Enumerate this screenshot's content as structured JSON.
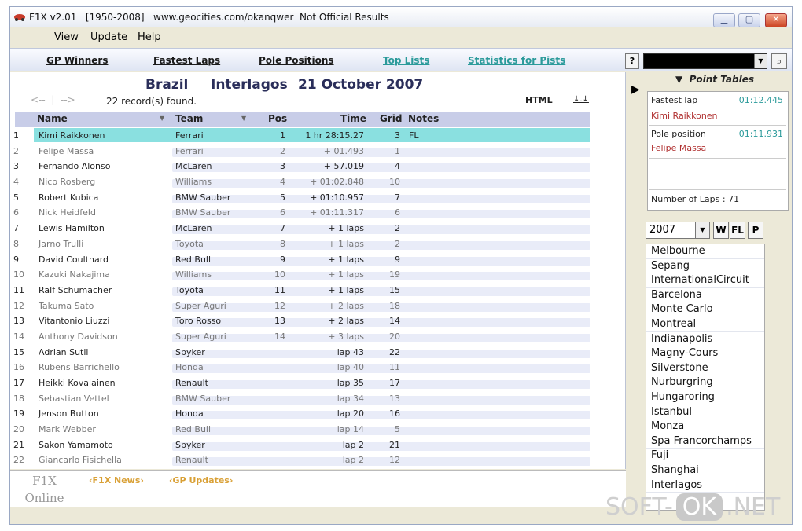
{
  "window": {
    "title": "F1X v2.01   [1950-2008]   www.geocities.com/okanqwer  Not Official Results"
  },
  "menu": {
    "items": [
      "View",
      "Update",
      "Help"
    ]
  },
  "nav": {
    "gp_winners": "GP Winners",
    "fastest_laps": "Fastest Laps",
    "pole_positions": "Pole Positions",
    "top_lists": "Top Lists",
    "statistics": "Statistics for Pists",
    "help": "?"
  },
  "race": {
    "country": "Brazil",
    "circuit": "Interlagos",
    "date": "21 October 2007"
  },
  "pager": {
    "back": "<--  |  -->",
    "records": "22  record(s) found.",
    "html": "HTML",
    "sort": "↓.↓"
  },
  "columns": {
    "name": "Name",
    "team": "Team",
    "pos": "Pos",
    "time": "Time",
    "grid": "Grid",
    "notes": "Notes"
  },
  "results": [
    {
      "n": "1",
      "name": "Kimi Raikkonen",
      "team": "Ferrari",
      "pos": "1",
      "time": "1 hr 28:15.27",
      "grid": "3",
      "notes": "FL"
    },
    {
      "n": "2",
      "name": "Felipe Massa",
      "team": "Ferrari",
      "pos": "2",
      "time": "+ 01.493",
      "grid": "1",
      "notes": ""
    },
    {
      "n": "3",
      "name": "Fernando Alonso",
      "team": "McLaren",
      "pos": "3",
      "time": "+ 57.019",
      "grid": "4",
      "notes": ""
    },
    {
      "n": "4",
      "name": "Nico Rosberg",
      "team": "Williams",
      "pos": "4",
      "time": "+ 01:02.848",
      "grid": "10",
      "notes": ""
    },
    {
      "n": "5",
      "name": "Robert Kubica",
      "team": "BMW Sauber",
      "pos": "5",
      "time": "+ 01:10.957",
      "grid": "7",
      "notes": ""
    },
    {
      "n": "6",
      "name": "Nick Heidfeld",
      "team": "BMW Sauber",
      "pos": "6",
      "time": "+ 01:11.317",
      "grid": "6",
      "notes": ""
    },
    {
      "n": "7",
      "name": "Lewis Hamilton",
      "team": "McLaren",
      "pos": "7",
      "time": "+ 1 laps",
      "grid": "2",
      "notes": ""
    },
    {
      "n": "8",
      "name": "Jarno Trulli",
      "team": "Toyota",
      "pos": "8",
      "time": "+ 1 laps",
      "grid": "2",
      "notes": ""
    },
    {
      "n": "9",
      "name": "David Coulthard",
      "team": "Red Bull",
      "pos": "9",
      "time": "+ 1 laps",
      "grid": "9",
      "notes": ""
    },
    {
      "n": "10",
      "name": "Kazuki Nakajima",
      "team": "Williams",
      "pos": "10",
      "time": "+ 1 laps",
      "grid": "19",
      "notes": ""
    },
    {
      "n": "11",
      "name": "Ralf Schumacher",
      "team": "Toyota",
      "pos": "11",
      "time": "+ 1 laps",
      "grid": "15",
      "notes": ""
    },
    {
      "n": "12",
      "name": "Takuma Sato",
      "team": "Super Aguri",
      "pos": "12",
      "time": "+ 2 laps",
      "grid": "18",
      "notes": ""
    },
    {
      "n": "13",
      "name": "Vitantonio Liuzzi",
      "team": "Toro Rosso",
      "pos": "13",
      "time": "+ 2 laps",
      "grid": "14",
      "notes": ""
    },
    {
      "n": "14",
      "name": "Anthony Davidson",
      "team": "Super Aguri",
      "pos": "14",
      "time": "+ 3 laps",
      "grid": "20",
      "notes": ""
    },
    {
      "n": "15",
      "name": "Adrian Sutil",
      "team": "Spyker",
      "pos": "",
      "time": "lap 43",
      "grid": "22",
      "notes": ""
    },
    {
      "n": "16",
      "name": "Rubens Barrichello",
      "team": "Honda",
      "pos": "",
      "time": "lap 40",
      "grid": "11",
      "notes": ""
    },
    {
      "n": "17",
      "name": "Heikki Kovalainen",
      "team": "Renault",
      "pos": "",
      "time": "lap 35",
      "grid": "17",
      "notes": ""
    },
    {
      "n": "18",
      "name": "Sebastian Vettel",
      "team": "BMW Sauber",
      "pos": "",
      "time": "lap 34",
      "grid": "13",
      "notes": ""
    },
    {
      "n": "19",
      "name": "Jenson Button",
      "team": "Honda",
      "pos": "",
      "time": "lap 20",
      "grid": "16",
      "notes": ""
    },
    {
      "n": "20",
      "name": "Mark Webber",
      "team": "Red Bull",
      "pos": "",
      "time": "lap 14",
      "grid": "5",
      "notes": ""
    },
    {
      "n": "21",
      "name": "Sakon Yamamoto",
      "team": "Spyker",
      "pos": "",
      "time": "lap 2",
      "grid": "21",
      "notes": ""
    },
    {
      "n": "22",
      "name": "Giancarlo Fisichella",
      "team": "Renault",
      "pos": "",
      "time": "lap 2",
      "grid": "12",
      "notes": ""
    }
  ],
  "news": {
    "logo_line1": "F1X",
    "logo_line2": "Online",
    "f1x_news": "‹F1X News›",
    "gp_updates": "‹GP Updates›"
  },
  "point_tables": {
    "title": "Point Tables",
    "fastest_lap_label": "Fastest lap",
    "fastest_lap_time": "01:12.445",
    "fastest_lap_driver": "Kimi Raikkonen",
    "pole_label": "Pole position",
    "pole_time": "01:11.931",
    "pole_driver": "Felipe Massa",
    "laps": "Number of Laps : 71"
  },
  "season": {
    "year": "2007",
    "buttons": [
      "W",
      "FL",
      "P"
    ]
  },
  "circuits": [
    "Melbourne",
    "Sepang",
    "InternationalCircuit",
    "Barcelona",
    "Monte Carlo",
    "Montreal",
    "Indianapolis",
    "Magny-Cours",
    "Silverstone",
    "Nurburgring",
    "Hungaroring",
    "Istanbul",
    "Monza",
    "Spa Francorchamps",
    "Fuji",
    "Shanghai",
    "Interlagos"
  ],
  "watermark": {
    "left": "SOFT-",
    "ok": "OK",
    "right": ".NET"
  },
  "colors": {
    "selected_row": "#8ae0e0",
    "header_band": "#c8cde8",
    "accent_teal": "#2a9a9a",
    "pole_red": "#b03030"
  }
}
